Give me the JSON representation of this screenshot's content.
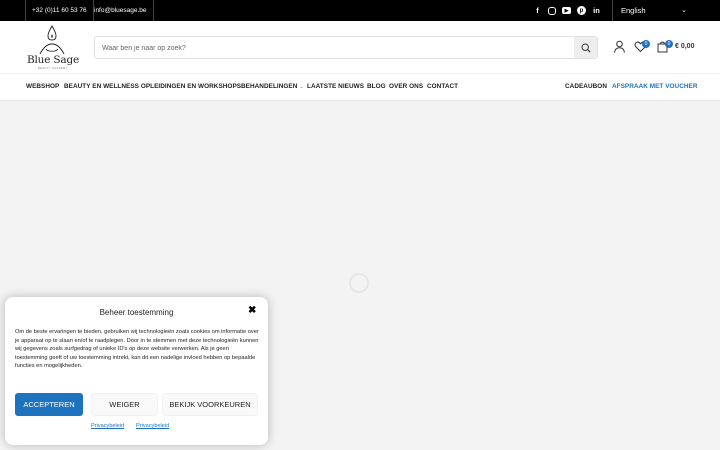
{
  "topbar": {
    "phone": "+32 (0)11 60 53 76",
    "email": "info@bluesage.be",
    "socials": [
      {
        "icon": "facebook-icon",
        "glyph": "f"
      },
      {
        "icon": "instagram-icon",
        "glyph": ""
      },
      {
        "icon": "youtube-icon",
        "glyph": "▶"
      },
      {
        "icon": "pinterest-icon",
        "glyph": "p"
      },
      {
        "icon": "linkedin-icon",
        "glyph": "in"
      }
    ],
    "language": "English"
  },
  "header": {
    "logo_text": "Blue Sage",
    "logo_subtext": "BEAUTY ACADEMY",
    "search_placeholder": "Waar ben je naar op zoek?",
    "wishlist_count": "0",
    "cart_count": "0",
    "cart_total": "€ 0,00"
  },
  "nav": {
    "items": [
      {
        "label": "WEBSHOP"
      },
      {
        "label": "BEAUTY EN WELLNESS OPLEIDINGEN EN WORKSHOPS"
      },
      {
        "label": "BEHANDELINGEN"
      },
      {
        "label": "LAATSTE NIEUWS"
      },
      {
        "label": "BLOG"
      },
      {
        "label": "OVER ONS"
      },
      {
        "label": "CONTACT"
      }
    ],
    "right": [
      {
        "label": "CADEAUBON"
      },
      {
        "label": "AFSPRAAK MET VOUCHER"
      }
    ]
  },
  "consent": {
    "title": "Beheer toestemming",
    "text": "Om de beste ervaringen te bieden, gebruiken wij technologieën zoals cookies om informatie over je apparaat op te slaan en/of te raadplegen. Door in te stemmen met deze technologieën kunnen wij gegevens zoals surfgedrag of unieke ID's op deze website verwerken. Als je geen toestemming geeft of uw toestemming intrekt, kan dit een nadelige invloed hebben op bepaalde functies en mogelijkheden.",
    "accept": "ACCEPTEREN",
    "deny": "WEIGER",
    "preferences": "BEKIJK VOORKEUREN",
    "links": [
      "Privacybeleid",
      "Privacybeleid"
    ]
  },
  "colors": {
    "accent": "#1e73be",
    "topbar_bg": "#000000",
    "page_bg": "#f3f3f3"
  }
}
